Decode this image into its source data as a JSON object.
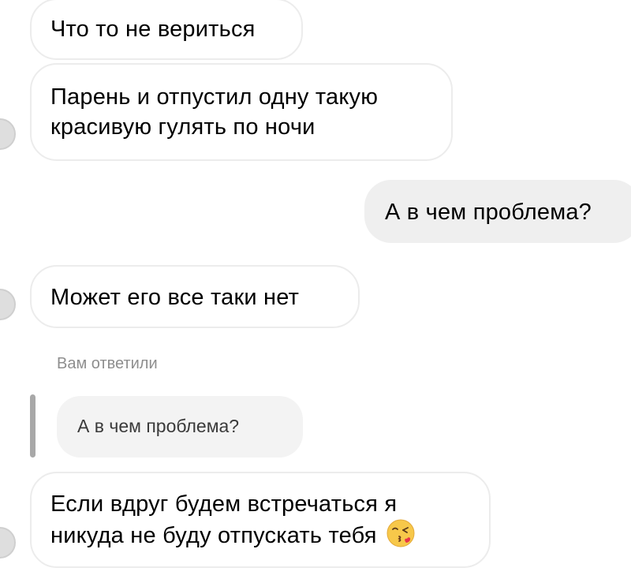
{
  "messages": [
    {
      "text": "Что то не вериться"
    },
    {
      "line1": "Парень и отпустил одну такую",
      "line2": "красивую гулять по ночи"
    },
    {
      "text": "А в чем проблема?"
    },
    {
      "text": "Может его все таки нет"
    },
    {
      "line1": "Если вдруг будем встречаться я",
      "line2": "никуда не буду отпускать тебя"
    }
  ],
  "reply": {
    "label": "Вам ответили",
    "quoted_text": "А в чем проблема?"
  },
  "emoji": {
    "icon": "face-blowing-kiss-icon"
  },
  "colors": {
    "incoming_bg": "#ffffff",
    "incoming_border": "#ececec",
    "outgoing_bg": "#efefef",
    "reply_bg": "#f3f3f3",
    "reply_label": "#8e8e8e"
  }
}
